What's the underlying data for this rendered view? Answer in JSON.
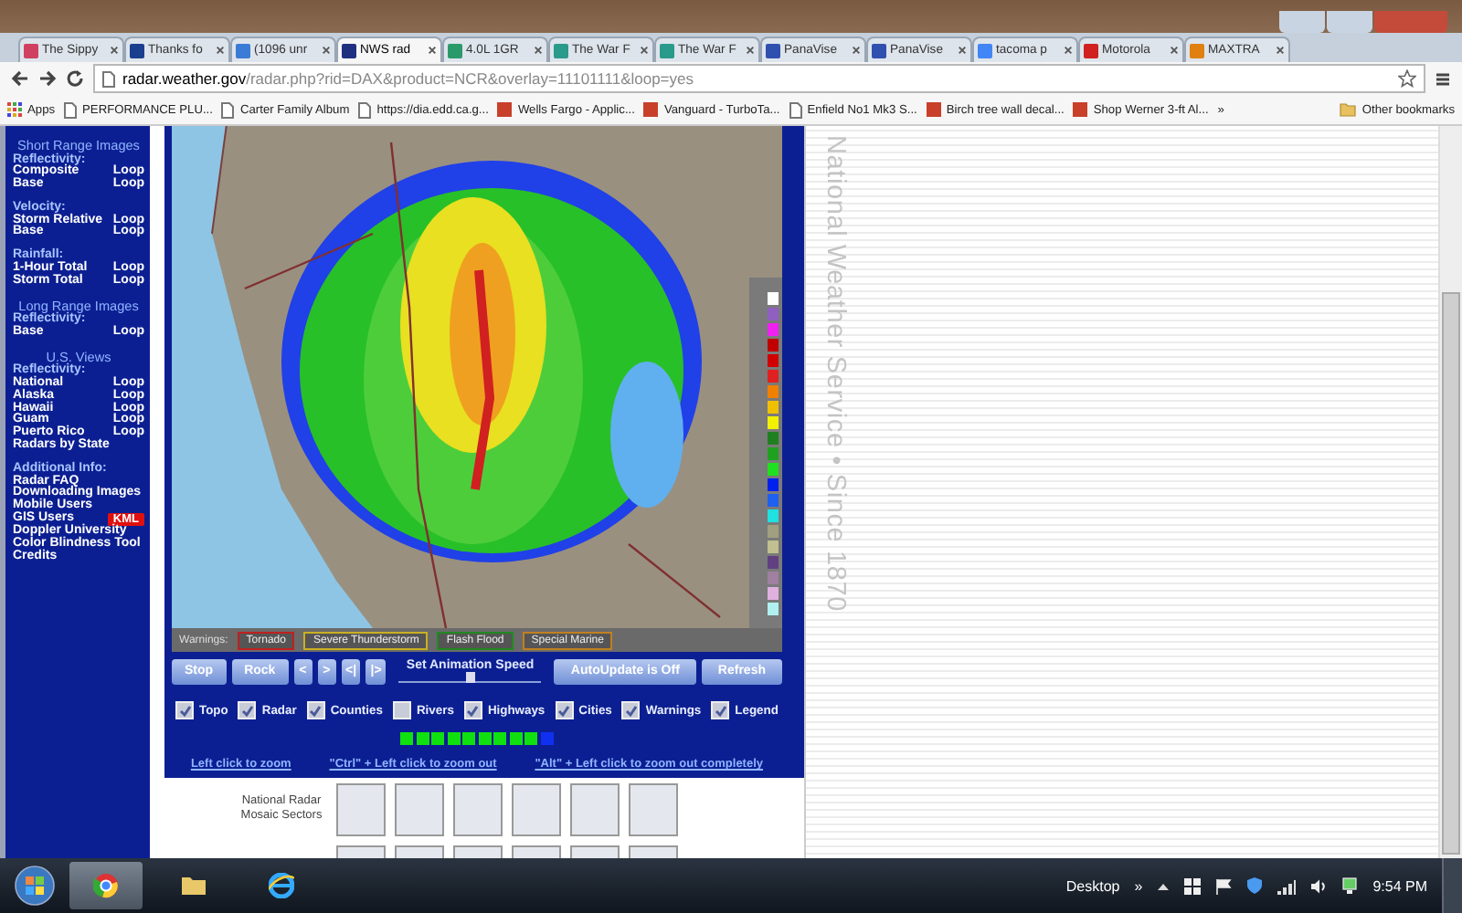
{
  "browser": {
    "tabs": [
      {
        "label": "The Sippy",
        "selected": false,
        "color": "#d04060"
      },
      {
        "label": "Thanks fo",
        "selected": false,
        "color": "#1a3f8f"
      },
      {
        "label": "(1096 unr",
        "selected": false,
        "color": "#3a7bd5"
      },
      {
        "label": "NWS rad",
        "selected": true,
        "color": "#203080"
      },
      {
        "label": "4.0L 1GR",
        "selected": false,
        "color": "#2a9a6a"
      },
      {
        "label": "The War F",
        "selected": false,
        "color": "#2a9a8a"
      },
      {
        "label": "The War F",
        "selected": false,
        "color": "#2a9a8a"
      },
      {
        "label": "PanaVise",
        "selected": false,
        "color": "#3050b0"
      },
      {
        "label": "PanaVise",
        "selected": false,
        "color": "#3050b0"
      },
      {
        "label": "tacoma p",
        "selected": false,
        "color": "#4285f4"
      },
      {
        "label": "Motorola",
        "selected": false,
        "color": "#d02020"
      },
      {
        "label": "MAXTRA",
        "selected": false,
        "color": "#e08010"
      }
    ],
    "url": {
      "host": "radar.weather.gov",
      "path": "/radar.php?rid=DAX&product=NCR&overlay=11101111&loop=yes"
    },
    "bookmarks": [
      {
        "label": "Apps",
        "kind": "apps"
      },
      {
        "label": "PERFORMANCE PLU...",
        "kind": "page"
      },
      {
        "label": "Carter Family Album",
        "kind": "page"
      },
      {
        "label": "https://dia.edd.ca.g...",
        "kind": "page"
      },
      {
        "label": "Wells Fargo - Applic...",
        "kind": "site"
      },
      {
        "label": "Vanguard - TurboTa...",
        "kind": "site"
      },
      {
        "label": "Enfield No1 Mk3 S...",
        "kind": "page"
      },
      {
        "label": "Birch tree wall decal...",
        "kind": "site"
      },
      {
        "label": "Shop Werner 3-ft Al...",
        "kind": "site"
      },
      {
        "label": "»",
        "kind": "more"
      },
      {
        "label": "Other bookmarks",
        "kind": "folder"
      }
    ]
  },
  "sidebar": {
    "sections": [
      {
        "title": "Short Range Images",
        "groups": [
          {
            "label": "Reflectivity:",
            "links": [
              {
                "text": "Composite",
                "loop": "Loop"
              },
              {
                "text": "Base",
                "loop": "Loop"
              }
            ]
          },
          {
            "label": "Velocity:",
            "links": [
              {
                "text": "Storm Relative",
                "loop": "Loop"
              },
              {
                "text": "Base",
                "loop": "Loop"
              }
            ]
          },
          {
            "label": "Rainfall:",
            "links": [
              {
                "text": "1-Hour Total",
                "loop": "Loop"
              },
              {
                "text": "Storm Total",
                "loop": "Loop"
              }
            ]
          }
        ]
      },
      {
        "title": "Long Range Images",
        "groups": [
          {
            "label": "Reflectivity:",
            "links": [
              {
                "text": "Base",
                "loop": "Loop"
              }
            ]
          }
        ]
      },
      {
        "title": "U.S. Views",
        "groups": [
          {
            "label": "Reflectivity:",
            "links": [
              {
                "text": "National",
                "loop": "Loop"
              },
              {
                "text": "Alaska",
                "loop": "Loop"
              },
              {
                "text": "Hawaii",
                "loop": "Loop"
              },
              {
                "text": "Guam",
                "loop": "Loop"
              },
              {
                "text": "Puerto Rico",
                "loop": "Loop"
              },
              {
                "text": "Radars by State"
              }
            ]
          }
        ]
      },
      {
        "groups": [
          {
            "label": "Additional Info:",
            "links": [
              {
                "text": "Radar FAQ"
              },
              {
                "text": "Downloading Images"
              },
              {
                "text": "Mobile Users"
              },
              {
                "text": "GIS Users",
                "badge": "KML"
              },
              {
                "text": "Doppler University"
              },
              {
                "text": "Color Blindness Tool"
              },
              {
                "text": "Credits"
              }
            ]
          }
        ]
      }
    ]
  },
  "radar": {
    "warnings": {
      "label": "Warnings:",
      "items": [
        {
          "label": "Tornado",
          "color": "#c02020"
        },
        {
          "label": "Severe Thunderstorm",
          "color": "#c8b020"
        },
        {
          "label": "Flash Flood",
          "color": "#208a20"
        },
        {
          "label": "Special Marine",
          "color": "#c08020"
        }
      ]
    },
    "buttons_left": [
      {
        "label": "Stop"
      },
      {
        "label": "Rock"
      },
      {
        "label": "<"
      },
      {
        "label": ">"
      },
      {
        "label": "<|"
      },
      {
        "label": "|>"
      }
    ],
    "speed": {
      "label": "Set Animation Speed",
      "level": 0.5
    },
    "buttons_right": [
      {
        "label": "AutoUpdate is Off"
      },
      {
        "label": "Refresh"
      }
    ],
    "layers": [
      {
        "label": "Topo",
        "checked": true
      },
      {
        "label": "Radar",
        "checked": true
      },
      {
        "label": "Counties",
        "checked": true
      },
      {
        "label": "Rivers",
        "checked": false
      },
      {
        "label": "Highways",
        "checked": true
      },
      {
        "label": "Cities",
        "checked": true
      },
      {
        "label": "Warnings",
        "checked": true
      },
      {
        "label": "Legend",
        "checked": true
      }
    ],
    "frames": [
      {
        "selected": false
      },
      {
        "selected": false
      },
      {
        "selected": false
      },
      {
        "selected": false
      },
      {
        "selected": false
      },
      {
        "selected": false
      },
      {
        "selected": false
      },
      {
        "selected": false
      },
      {
        "selected": false
      },
      {
        "selected": true
      }
    ],
    "zoom_help": [
      "Left click to zoom",
      "\"Ctrl\" + Left click to zoom out",
      "\"Alt\" + Left click to zoom out completely"
    ],
    "sectors_label": "National Radar Mosaic Sectors"
  },
  "side_banner": "National Weather Service • Since 1870",
  "taskbar": {
    "desktop_label": "Desktop",
    "overflow": "»",
    "clock": "9:54 PM"
  }
}
